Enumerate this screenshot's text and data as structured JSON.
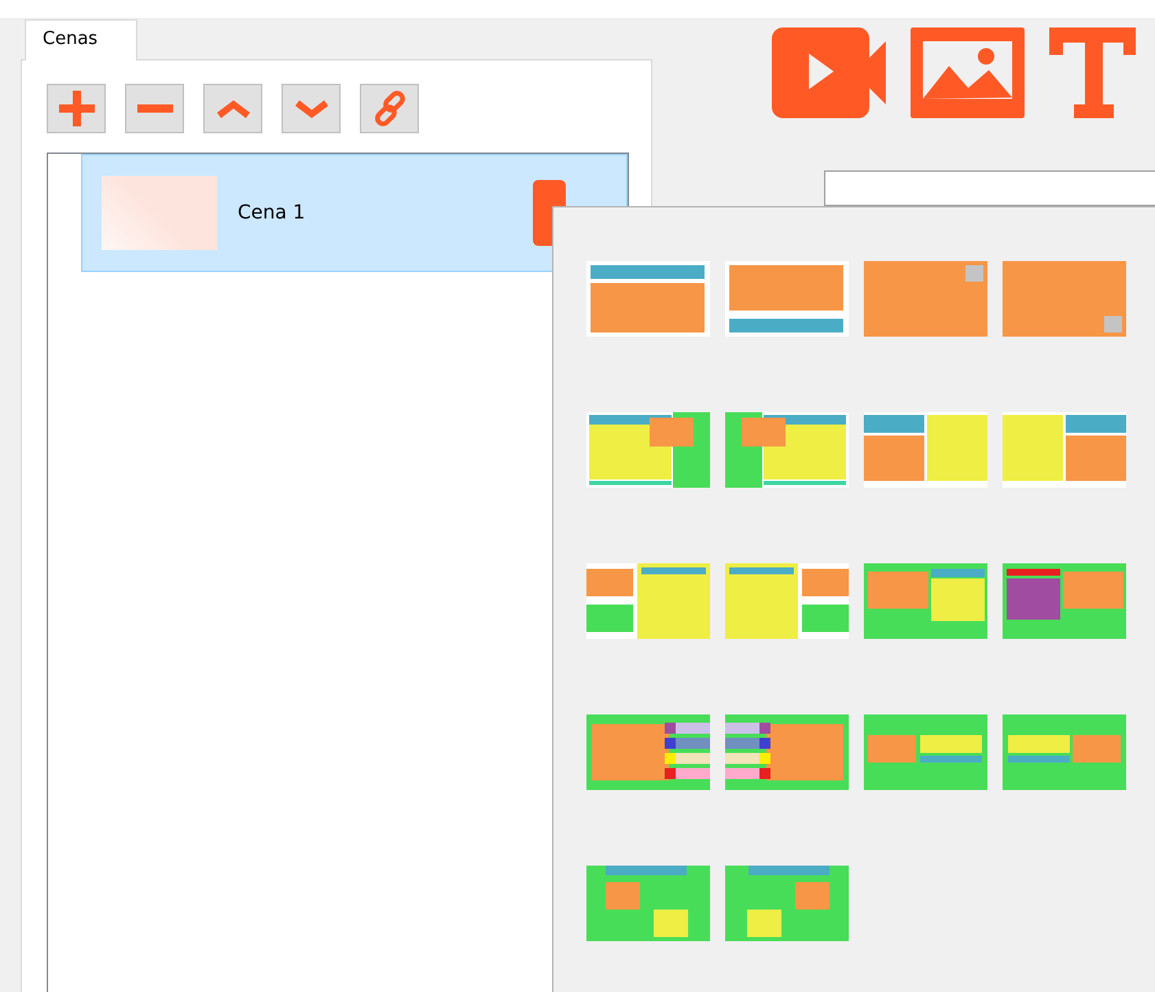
{
  "tabs": [
    {
      "label": "Cenas",
      "selected": true
    }
  ],
  "scenes": [
    {
      "label": "Cena 1",
      "selected": true
    }
  ]
}
